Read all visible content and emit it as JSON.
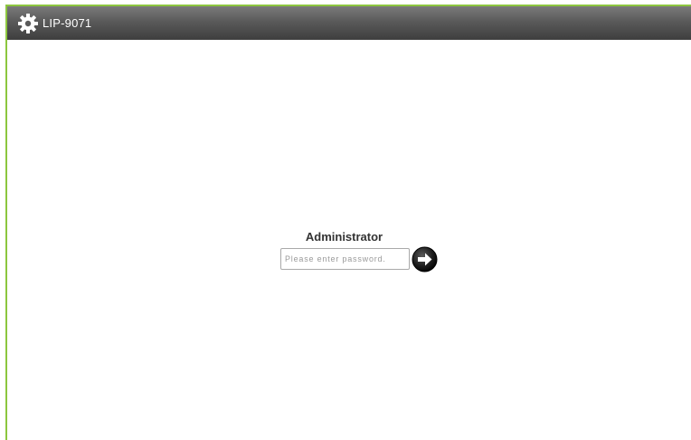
{
  "app": {
    "title": "LIP-9071"
  },
  "icons": {
    "logo": "gear-icon",
    "submit": "arrow-right-circle-icon"
  },
  "colors": {
    "frame_accent": "#8cc63f",
    "titlebar_top": "#7a7a7a",
    "titlebar_bottom": "#3e3e3e"
  },
  "login": {
    "user_label": "Administrator",
    "password": {
      "value": "",
      "placeholder": "Please enter password."
    }
  }
}
